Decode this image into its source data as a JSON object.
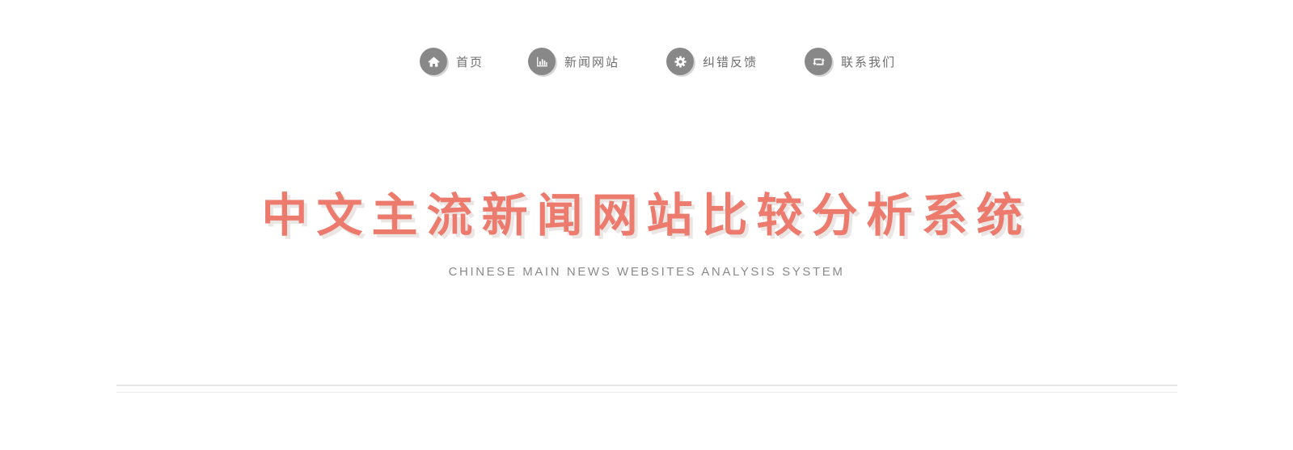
{
  "nav": {
    "items": [
      {
        "label": "首页",
        "icon": "home-icon"
      },
      {
        "label": "新闻网站",
        "icon": "bar-chart-icon"
      },
      {
        "label": "纠错反馈",
        "icon": "gear-icon"
      },
      {
        "label": "联系我们",
        "icon": "retweet-icon"
      }
    ]
  },
  "hero": {
    "title": "中文主流新闻网站比较分析系统",
    "subtitle": "CHINESE MAIN NEWS WEBSITES ANALYSIS SYSTEM"
  },
  "colors": {
    "accent": "#ec7b6e",
    "icon_background": "#888888",
    "nav_text": "#6f6f6f",
    "subtitle_text": "#8a8a8a",
    "divider": "#e6e6e6"
  }
}
